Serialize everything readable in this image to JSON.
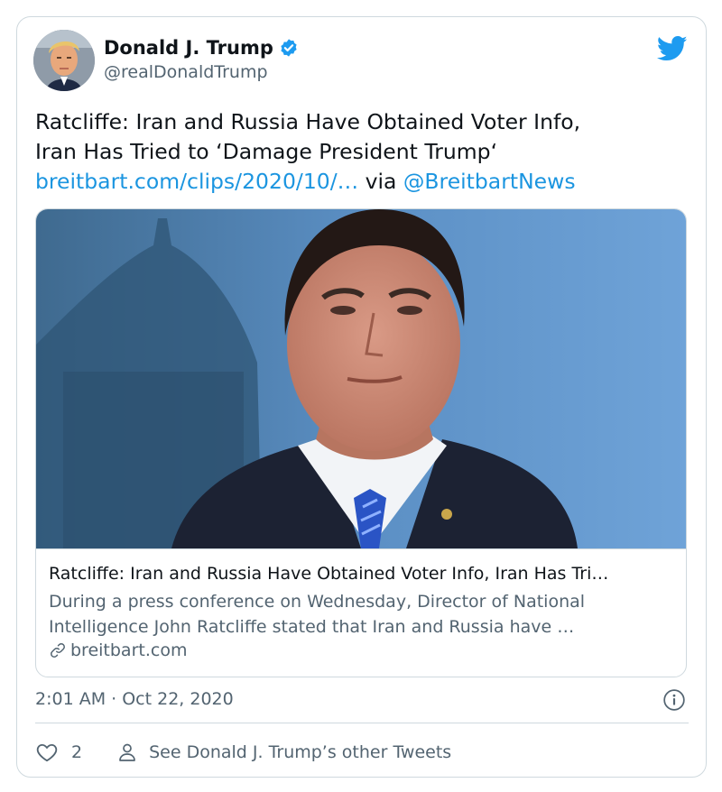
{
  "author": {
    "name": "Donald J. Trump",
    "handle": "@realDonaldTrump",
    "verified": true
  },
  "tweet": {
    "text_line1": "Ratcliffe: Iran and Russia Have Obtained Voter Info,",
    "text_line2": "Iran Has Tried to ‘Damage President Trump‘",
    "link": "breitbart.com/clips/2020/10/…",
    "via": " via ",
    "mention": "@BreitbartNews"
  },
  "link_card": {
    "title": "Ratcliffe: Iran and Russia Have Obtained Voter Info, Iran Has Tri…",
    "description_line1": "During a press conference on Wednesday, Director of National",
    "description_line2": "Intelligence John Ratcliffe stated that Iran and Russia have …",
    "domain": "breitbart.com"
  },
  "timestamp": "2:01 AM · Oct 22, 2020",
  "actions": {
    "like_count": "2",
    "other_tweets": "See Donald J. Trump’s other Tweets"
  },
  "icons": {
    "brand": "twitter-bird-icon",
    "verified": "verified-badge-icon",
    "info": "info-icon",
    "like": "heart-icon",
    "profile": "person-icon",
    "link": "link-icon"
  },
  "colors": {
    "twitter_blue": "#1d9bf0",
    "link_blue": "#1b95e0",
    "text_primary": "#0f1419",
    "text_secondary": "#536471",
    "border": "#cfd9de"
  }
}
